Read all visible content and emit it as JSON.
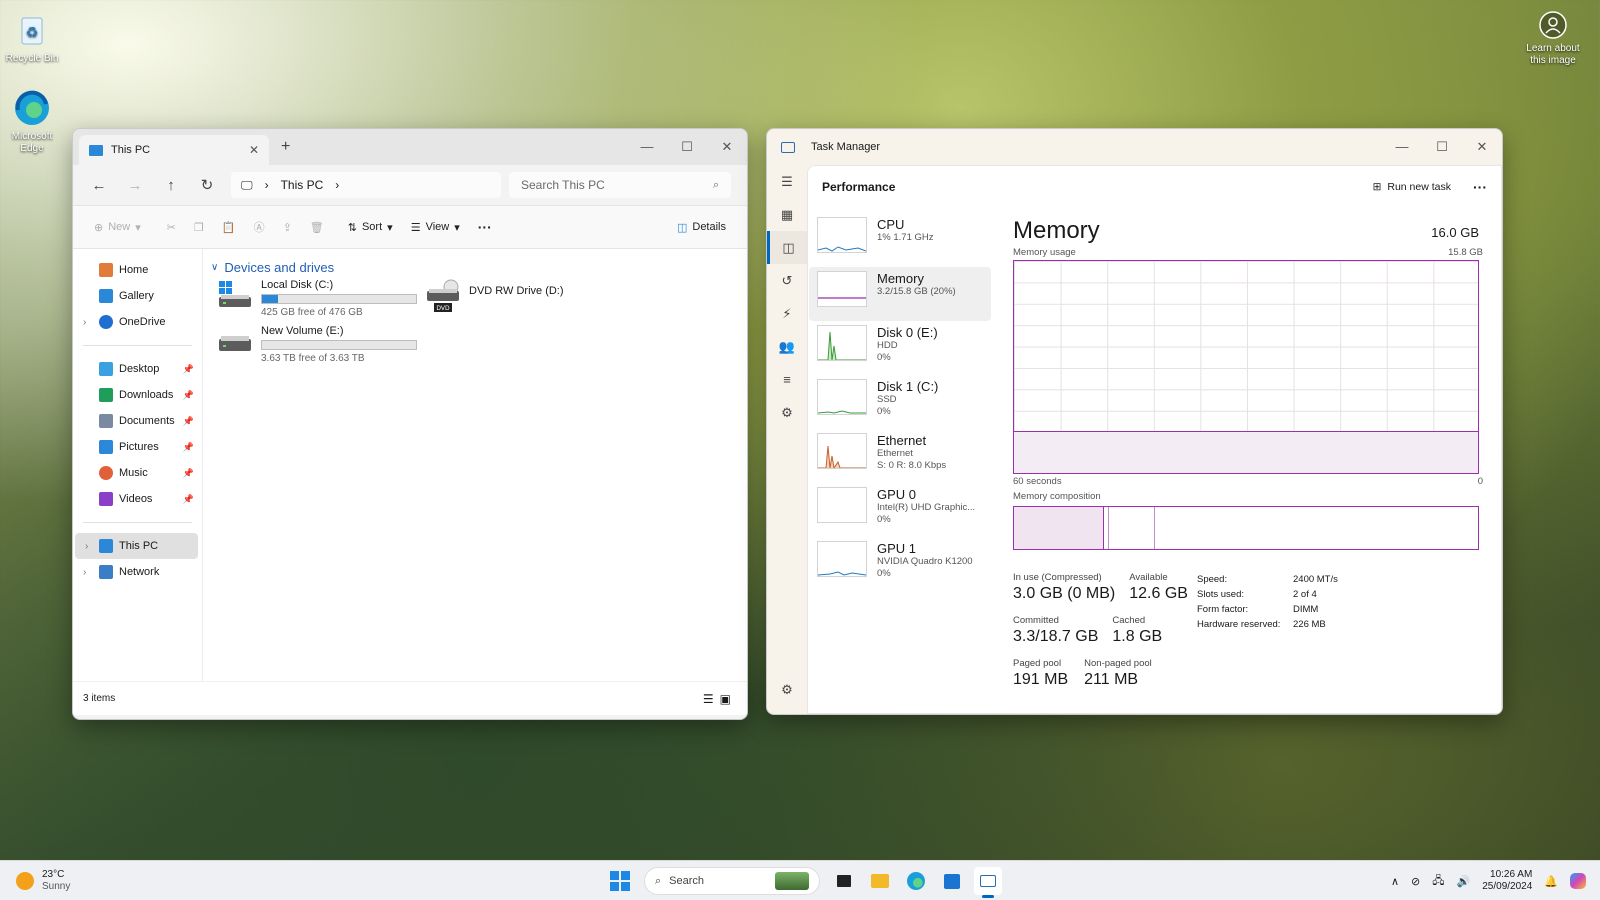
{
  "desktop": {
    "recycle_bin": "Recycle Bin",
    "edge": "Microsoft Edge",
    "learn_about": "Learn about this image"
  },
  "explorer": {
    "tab_title": "This PC",
    "breadcrumb": "This PC",
    "search_placeholder": "Search This PC",
    "commands": {
      "new": "New",
      "sort": "Sort",
      "view": "View",
      "details": "Details"
    },
    "sidebar": {
      "home": "Home",
      "gallery": "Gallery",
      "onedrive": "OneDrive",
      "desktop": "Desktop",
      "downloads": "Downloads",
      "documents": "Documents",
      "pictures": "Pictures",
      "music": "Music",
      "videos": "Videos",
      "thispc": "This PC",
      "network": "Network"
    },
    "group": "Devices and drives",
    "drives": {
      "c": {
        "name": "Local Disk (C:)",
        "free": "425 GB free of 476 GB",
        "used": 0.107
      },
      "e": {
        "name": "New Volume (E:)",
        "free": "3.63 TB free of 3.63 TB",
        "used": 0.0
      },
      "d": {
        "name": "DVD RW Drive (D:)",
        "badge": "DVD"
      }
    },
    "status": "3 items"
  },
  "taskmanager": {
    "title": "Task Manager",
    "section": "Performance",
    "run_new_task": "Run new task",
    "items": {
      "cpu": {
        "name": "CPU",
        "sub": "1% 1.71 GHz"
      },
      "memory": {
        "name": "Memory",
        "sub": "3.2/15.8 GB (20%)"
      },
      "disk0": {
        "name": "Disk 0 (E:)",
        "sub1": "HDD",
        "sub2": "0%"
      },
      "disk1": {
        "name": "Disk 1 (C:)",
        "sub1": "SSD",
        "sub2": "0%"
      },
      "ethernet": {
        "name": "Ethernet",
        "sub1": "Ethernet",
        "sub2": "S: 0 R: 8.0 Kbps"
      },
      "gpu0": {
        "name": "GPU 0",
        "sub1": "Intel(R) UHD Graphic...",
        "sub2": "0%"
      },
      "gpu1": {
        "name": "GPU 1",
        "sub1": "NVIDIA Quadro K1200",
        "sub2": "0%"
      }
    },
    "memory": {
      "title": "Memory",
      "capacity": "16.0 GB",
      "usage_label": "Memory usage",
      "usage_max": "15.8 GB",
      "time_left": "60 seconds",
      "time_right": "0",
      "composition_label": "Memory composition",
      "usage_level": 0.2,
      "stats": {
        "inuse_l": "In use (Compressed)",
        "inuse_v": "3.0 GB (0 MB)",
        "avail_l": "Available",
        "avail_v": "12.6 GB",
        "commit_l": "Committed",
        "commit_v": "3.3/18.7 GB",
        "cached_l": "Cached",
        "cached_v": "1.8 GB",
        "paged_l": "Paged pool",
        "paged_v": "191 MB",
        "nonpaged_l": "Non-paged pool",
        "nonpaged_v": "211 MB"
      },
      "details": {
        "speed_l": "Speed:",
        "speed_v": "2400 MT/s",
        "slots_l": "Slots used:",
        "slots_v": "2 of 4",
        "form_l": "Form factor:",
        "form_v": "DIMM",
        "hw_l": "Hardware reserved:",
        "hw_v": "226 MB"
      }
    }
  },
  "taskbar": {
    "weather_temp": "23°C",
    "weather_desc": "Sunny",
    "search_placeholder": "Search",
    "time": "10:26 AM",
    "date": "25/09/2024"
  },
  "colors": {
    "accent": "#0067c0",
    "memory": "#9b2fae",
    "drive_bar": "#2b88d8"
  }
}
